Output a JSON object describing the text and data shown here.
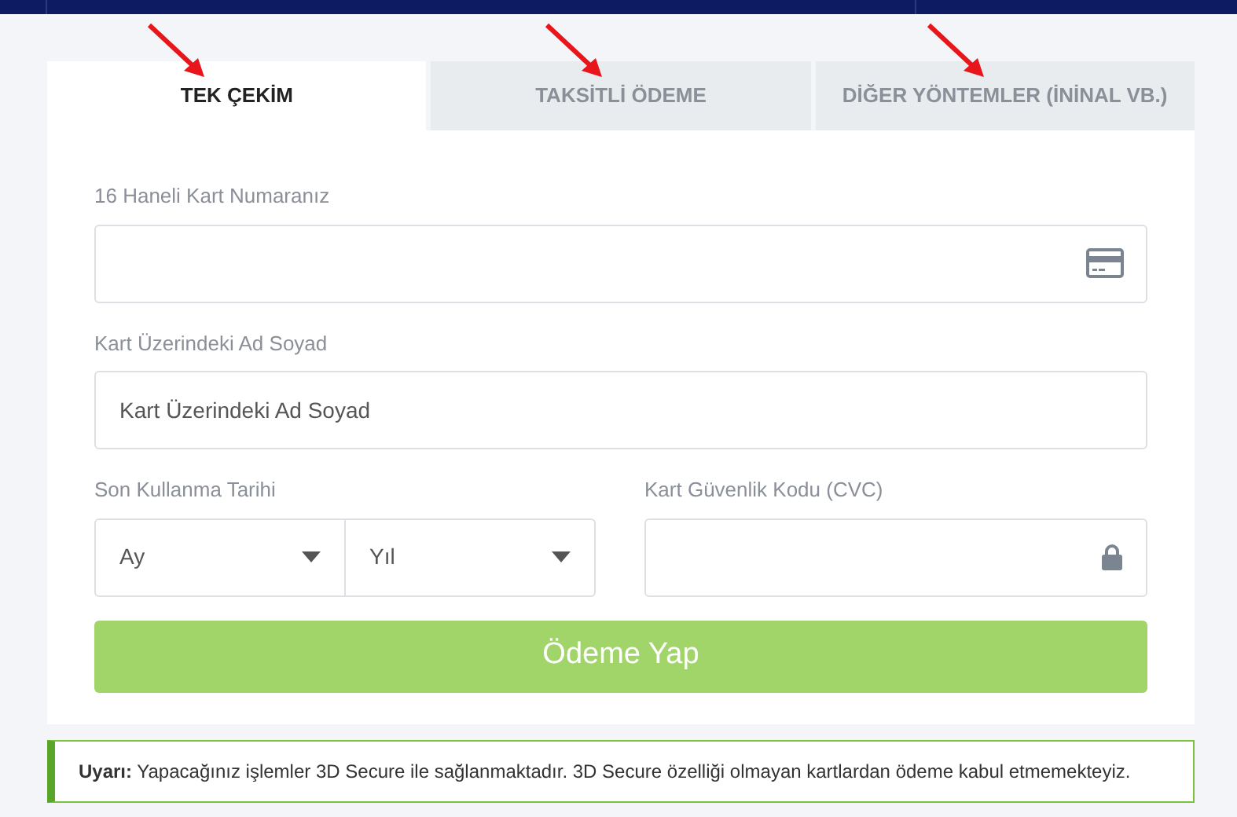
{
  "tabs": [
    {
      "label": "TEK ÇEKİM",
      "selected": true
    },
    {
      "label": "TAKSİTLİ ÖDEME",
      "selected": false
    },
    {
      "label": "DİĞER YÖNTEMLER (İNİNAL VB.)",
      "selected": false
    }
  ],
  "card_number": {
    "label": "16 Haneli Kart Numaranız"
  },
  "card_name": {
    "label": "Kart Üzerindeki Ad Soyad",
    "placeholder": "Kart Üzerindeki Ad Soyad"
  },
  "expiry": {
    "label": "Son Kullanma Tarihi",
    "month": "Ay",
    "year": "Yıl"
  },
  "cvc": {
    "label": "Kart Güvenlik Kodu (CVC)"
  },
  "submit": {
    "label": "Ödeme Yap",
    "disabled": true
  },
  "warning": {
    "text": "**Uyarı:** Yapacağınız işlemler 3D Secure ile sağlanmaktadır. 3D Secure özelliği olmayan kartlardan ödeme kabul etmemekteyiz."
  }
}
